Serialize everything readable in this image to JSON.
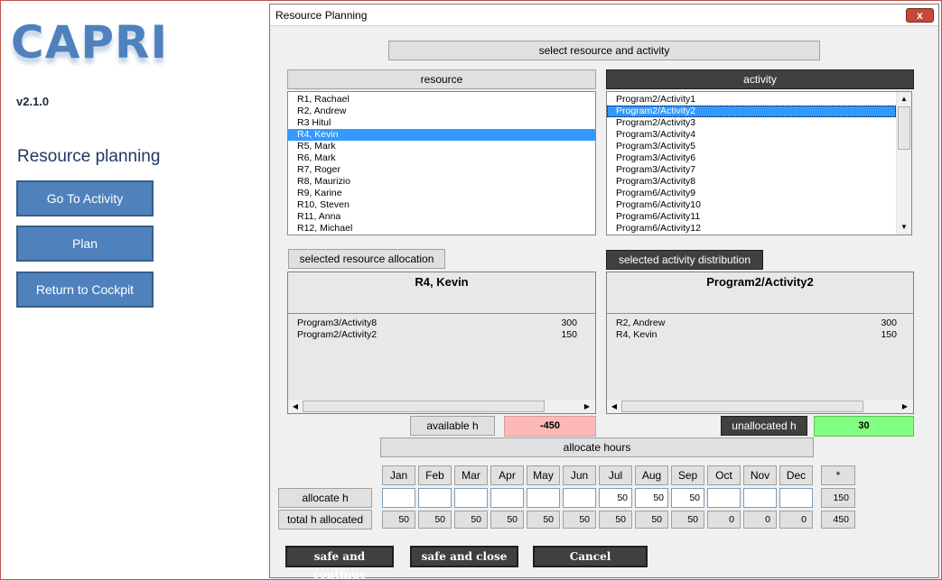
{
  "app": {
    "logo": "CAPRI",
    "version": "v2.1.0",
    "heading": "Resource planning",
    "buttons": [
      "Go To Activity",
      "Plan",
      "Return to Cockpit"
    ]
  },
  "dialog": {
    "title": "Resource Planning",
    "close_symbol": "x",
    "select_header": "select resource and activity",
    "resource_header": "resource",
    "activity_header": "activity",
    "resources": [
      "R1, Rachael",
      "R2, Andrew",
      "R3 Hitul",
      "R4, Kevin",
      "R5, Mark",
      "R6, Mark",
      "R7, Roger",
      "R8, Maurizio",
      "R9, Karine",
      "R10, Steven",
      "R11, Anna",
      "R12, Michael"
    ],
    "selected_resource_index": 3,
    "activities": [
      "Program2/Activity1",
      "Program2/Activity2",
      "Program2/Activity3",
      "Program3/Activity4",
      "Program3/Activity5",
      "Program3/Activity6",
      "Program3/Activity7",
      "Program3/Activity8",
      "Program6/Activity9",
      "Program6/Activity10",
      "Program6/Activity11",
      "Program6/Activity12"
    ],
    "selected_activity_index": 1,
    "resource_alloc_label": "selected resource allocation",
    "activity_dist_label": "selected activity distribution",
    "selected_resource": "R4, Kevin",
    "selected_activity": "Program2/Activity2",
    "resource_alloc": [
      {
        "name": "Program3/Activity8",
        "hours": "300"
      },
      {
        "name": "Program2/Activity2",
        "hours": "150"
      }
    ],
    "activity_dist": [
      {
        "name": "R2, Andrew",
        "hours": "300"
      },
      {
        "name": "R4, Kevin",
        "hours": "150"
      }
    ],
    "available_label": "available h",
    "available_value": "-450",
    "unallocated_label": "unallocated h",
    "unallocated_value": "30",
    "allocate_header": "allocate hours",
    "months": [
      "Jan",
      "Feb",
      "Mar",
      "Apr",
      "May",
      "Jun",
      "Jul",
      "Aug",
      "Sep",
      "Oct",
      "Nov",
      "Dec"
    ],
    "star": "*",
    "allocate_label": "allocate h",
    "allocate_values": [
      "",
      "",
      "",
      "",
      "",
      "",
      "50",
      "50",
      "50",
      "",
      "",
      ""
    ],
    "allocate_total": "150",
    "total_label": "total h allocated",
    "total_values": [
      "50",
      "50",
      "50",
      "50",
      "50",
      "50",
      "50",
      "50",
      "50",
      "0",
      "0",
      "0"
    ],
    "total_total": "450",
    "bottom_buttons": [
      "safe and continue",
      "safe and close",
      "Cancel"
    ],
    "colors": {
      "available_bg": "#ffb8b8",
      "unallocated_bg": "#80ff80",
      "accent": "#4f81bd",
      "selection": "#3399ff"
    }
  }
}
